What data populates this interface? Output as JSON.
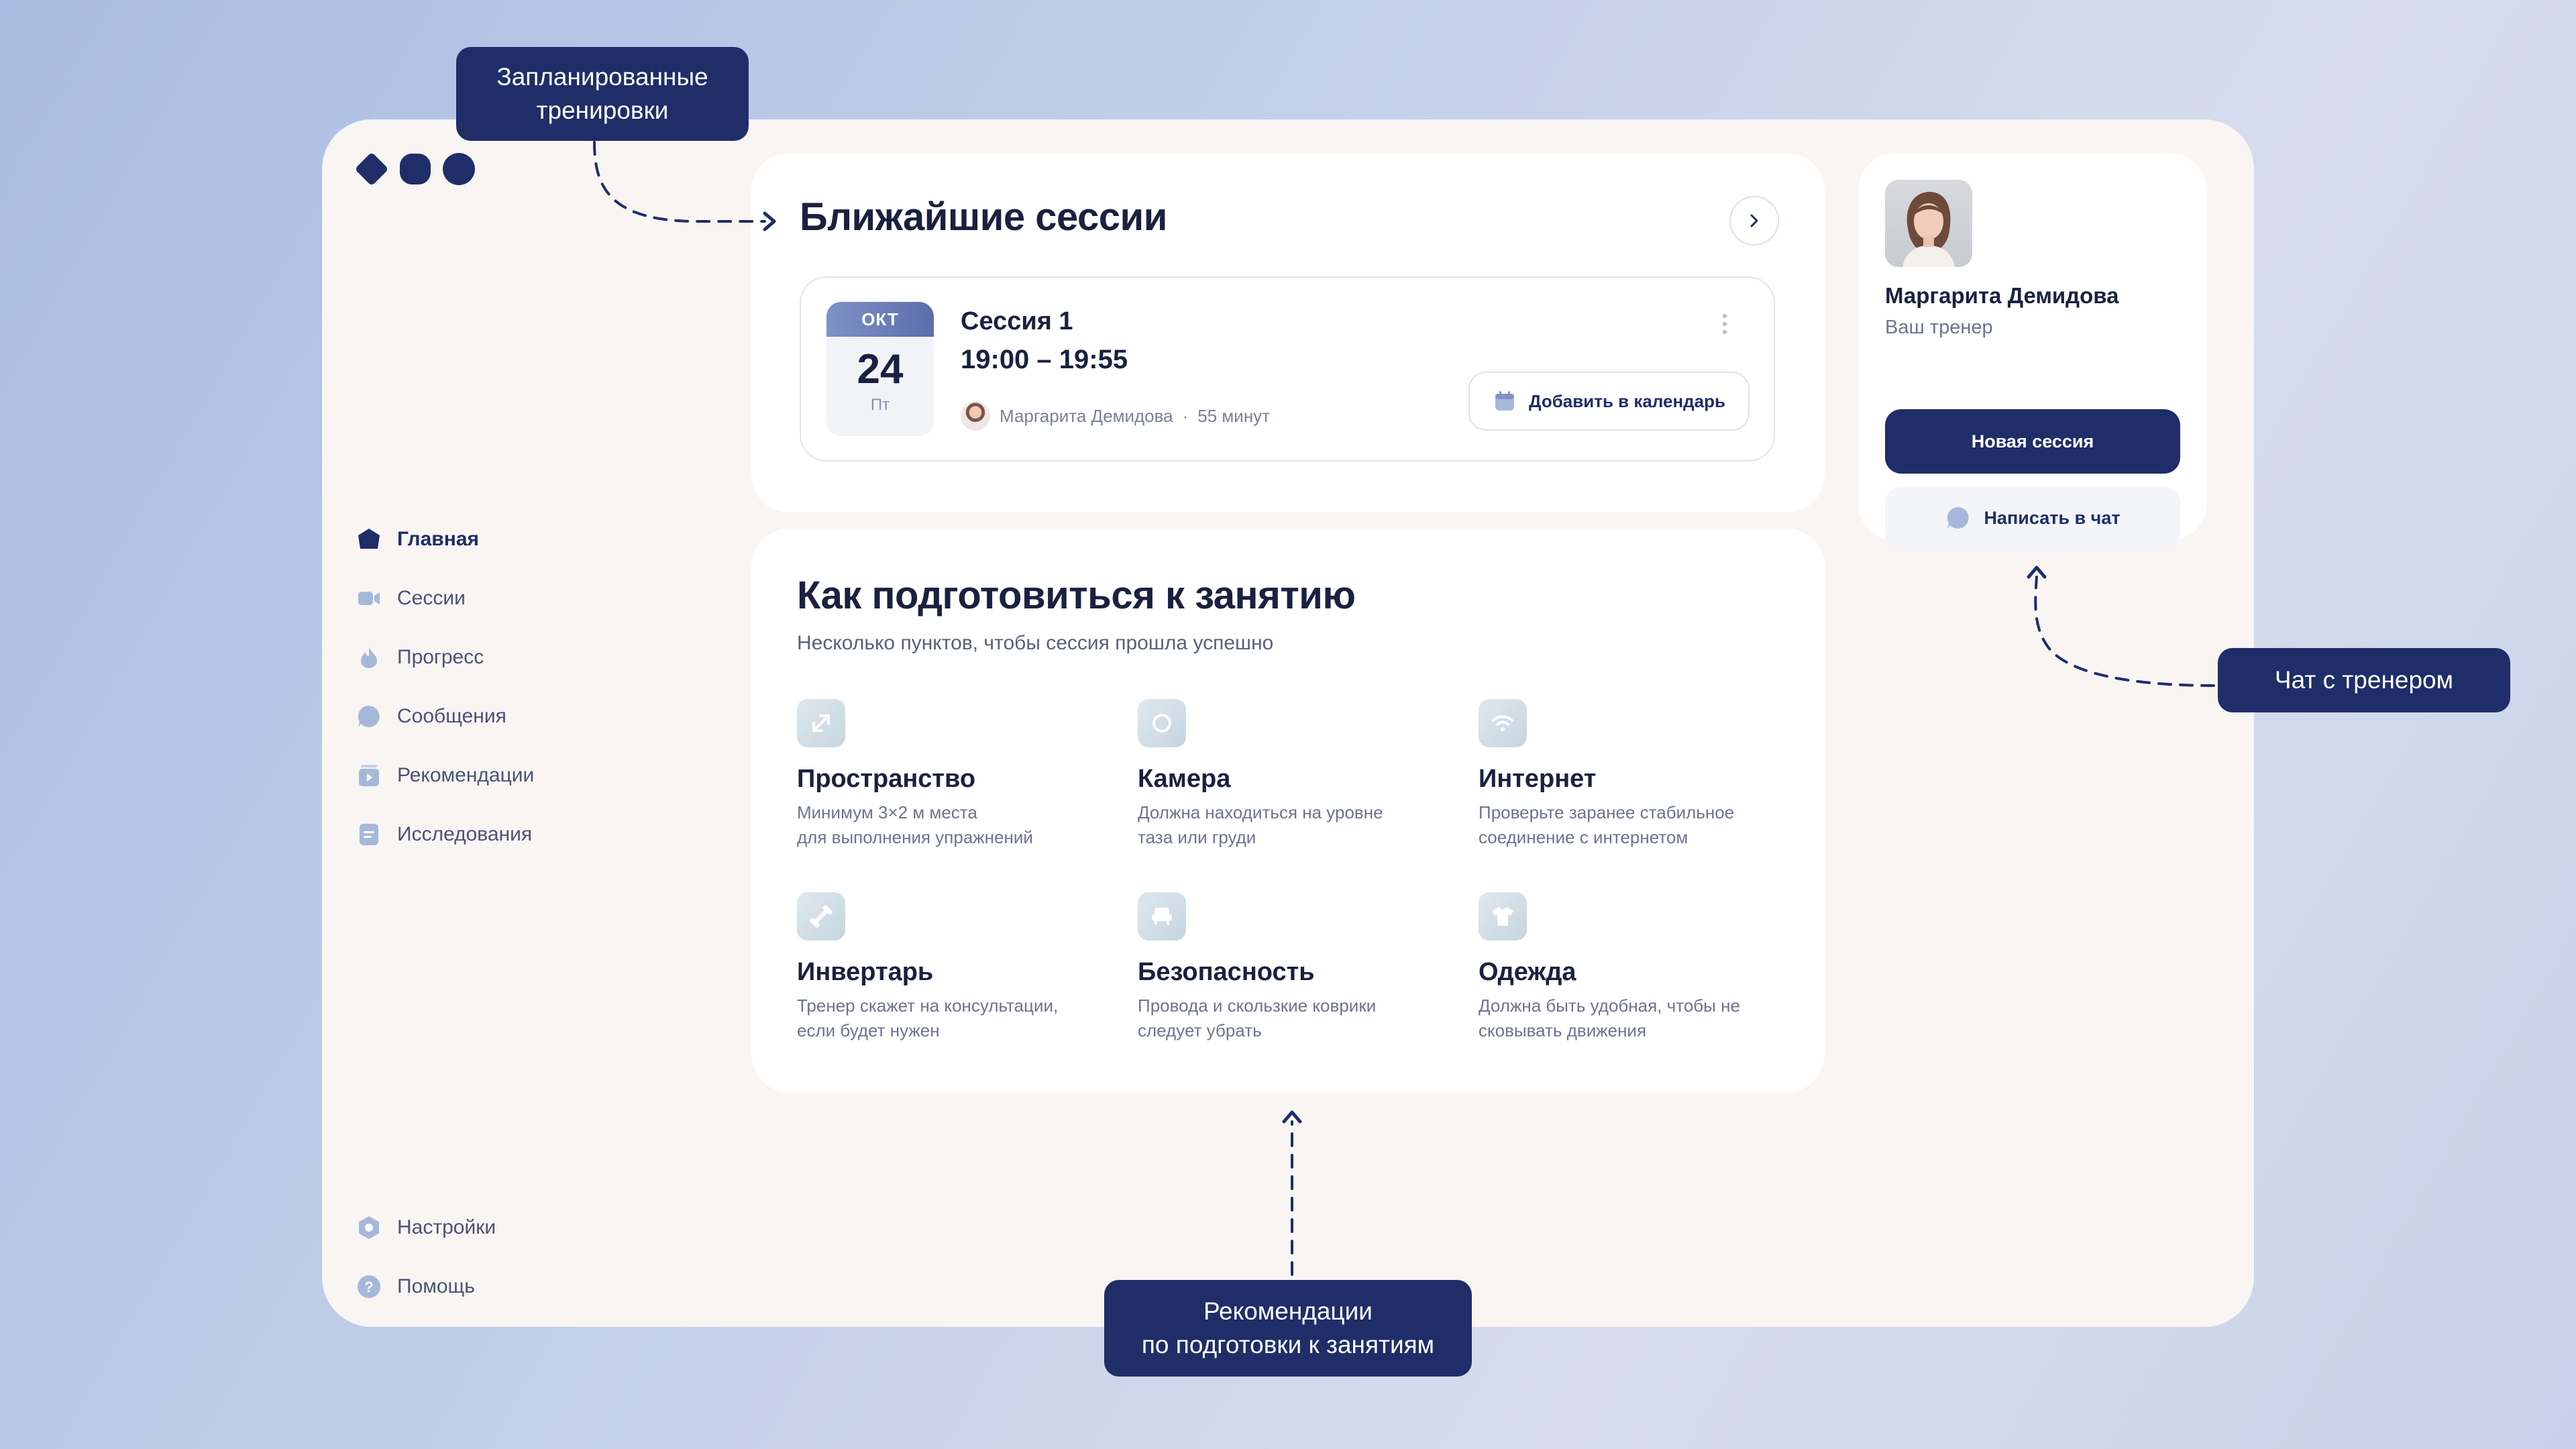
{
  "colors": {
    "accent": "#1f2d69",
    "background": "#f8f5f3",
    "card": "#ffffff",
    "muted_icon": "#a6b8da"
  },
  "sidebar": {
    "items": [
      {
        "label": "Главная",
        "icon": "home-icon",
        "active": true
      },
      {
        "label": "Сессии",
        "icon": "video-icon"
      },
      {
        "label": "Прогресс",
        "icon": "progress-icon"
      },
      {
        "label": "Сообщения",
        "icon": "message-icon"
      },
      {
        "label": "Рекомендации",
        "icon": "play-icon"
      },
      {
        "label": "Исследования",
        "icon": "document-icon"
      }
    ],
    "bottom": [
      {
        "label": "Настройки",
        "icon": "settings-icon"
      },
      {
        "label": "Помощь",
        "icon": "help-icon"
      }
    ]
  },
  "sessions": {
    "title": "Ближайшие сессии",
    "item": {
      "month": "ОКТ",
      "day": "24",
      "weekday": "Пт",
      "title": "Сессия 1",
      "time": "19:00 – 19:55",
      "trainer": "Маргарита Демидова",
      "separator": "·",
      "duration": "55 минут",
      "add_calendar": "Добавить в календарь"
    }
  },
  "prepare": {
    "title": "Как подготовиться к занятию",
    "subtitle": "Несколько пунктов, чтобы сессия прошла успешно",
    "tips": [
      {
        "title": "Пространство",
        "desc": "Минимум 3×2 м места\nдля выполнения упражнений",
        "icon": "expand-icon"
      },
      {
        "title": "Камера",
        "desc": "Должна находиться на уровне\nтаза или груди",
        "icon": "camera-icon"
      },
      {
        "title": "Интернет",
        "desc": "Проверьте заранее стабильное\nсоединение с интернетом",
        "icon": "wifi-icon"
      },
      {
        "title": "Инвертарь",
        "desc": "Тренер скажет на консультации,\nесли будет нужен",
        "icon": "dumbbell-icon"
      },
      {
        "title": "Безопасность",
        "desc": "Провода и скользкие коврики\nследует убрать",
        "icon": "chair-icon"
      },
      {
        "title": "Одежда",
        "desc": "Должна быть удобная, чтобы не\nсковывать движения",
        "icon": "shirt-icon"
      }
    ]
  },
  "coach": {
    "name": "Маргарита Демидова",
    "role": "Ваш тренер",
    "new_session": "Новая сессия",
    "chat": "Написать в чат"
  },
  "callouts": {
    "scheduled": "Запланированные\nтренировки",
    "chat": "Чат с тренером",
    "recommendations": "Рекомендации\nпо подготовки к занятиям"
  }
}
